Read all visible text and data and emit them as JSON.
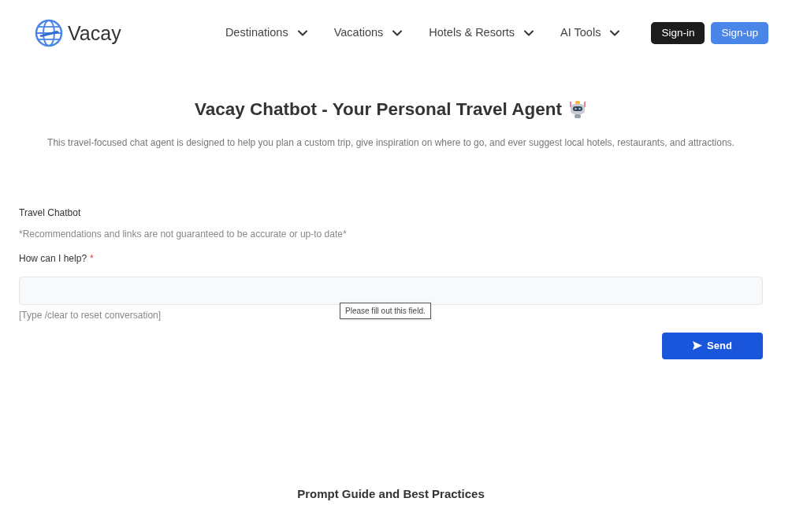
{
  "header": {
    "logo": {
      "text": "Vacay"
    },
    "nav": [
      {
        "label": "Destinations"
      },
      {
        "label": "Vacations"
      },
      {
        "label": "Hotels & Resorts"
      },
      {
        "label": "AI Tools"
      }
    ],
    "buttons": [
      {
        "label": "Sign-in",
        "kind": "dark"
      },
      {
        "label": "Sign-up",
        "kind": "primary"
      }
    ]
  },
  "hero": {
    "title": "Vacay Chatbot - Your Personal Travel Agent",
    "subtitle": "This travel-focused chat agent is designed to help you plan a custom trip, give inspiration on where to go, and ever suggest local hotels, restaurants, and attractions."
  },
  "chat_form": {
    "heading": "Travel Chatbot",
    "disclaimer": "*Recommendations and links are not guaranteed to be accurate or up-to date*",
    "field": {
      "label": "How can I help?",
      "required_mark": "*",
      "hint": "[Type /clear to reset conversation]",
      "tooltip": "Please fill out this field."
    },
    "submit": {
      "label": "Send"
    }
  },
  "section_heading": "Prompt Guide and Best Practices"
}
